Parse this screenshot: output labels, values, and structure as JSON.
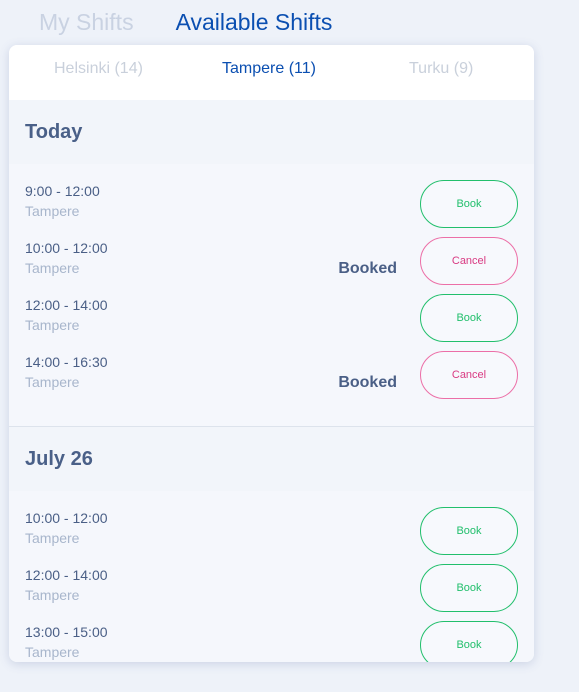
{
  "top_tabs": {
    "my_shifts": "My Shifts",
    "available_shifts": "Available Shifts"
  },
  "city_tabs": {
    "helsinki": "Helsinki (14)",
    "tampere": "Tampere (11)",
    "turku": "Turku (9)"
  },
  "days": [
    {
      "title": "Today",
      "shifts": [
        {
          "time": "9:00 - 12:00",
          "location": "Tampere",
          "status": "",
          "action": "Book"
        },
        {
          "time": "10:00 - 12:00",
          "location": "Tampere",
          "status": "Booked",
          "action": "Cancel"
        },
        {
          "time": "12:00 - 14:00",
          "location": "Tampere",
          "status": "",
          "action": "Book"
        },
        {
          "time": "14:00 - 16:30",
          "location": "Tampere",
          "status": "Booked",
          "action": "Cancel"
        }
      ]
    },
    {
      "title": "July 26",
      "shifts": [
        {
          "time": "10:00 - 12:00",
          "location": "Tampere",
          "status": "",
          "action": "Book"
        },
        {
          "time": "12:00 - 14:00",
          "location": "Tampere",
          "status": "",
          "action": "Book"
        },
        {
          "time": "13:00 - 15:00",
          "location": "Tampere",
          "status": "",
          "action": "Book"
        }
      ]
    }
  ],
  "colors": {
    "accent": "#0b4fb1",
    "book": "#22bf6c",
    "cancel": "#d93a82"
  }
}
